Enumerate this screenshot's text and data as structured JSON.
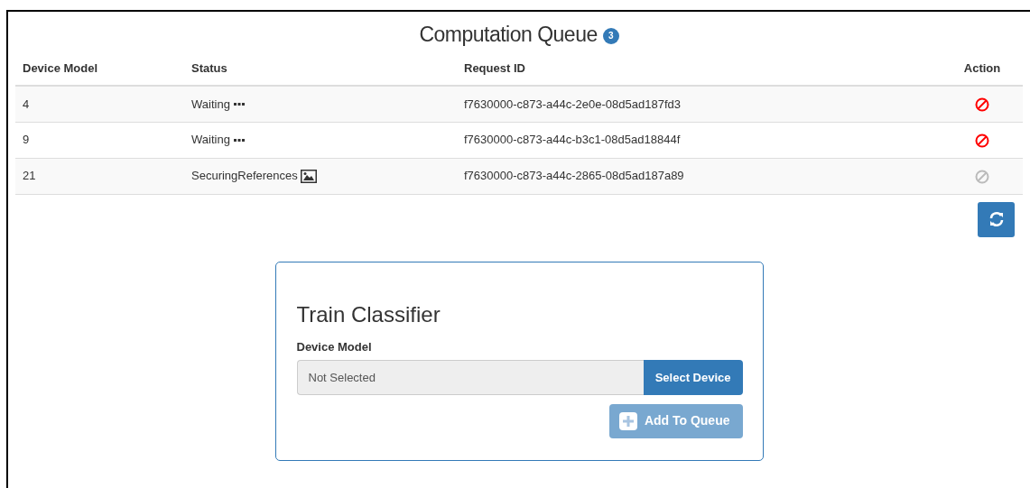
{
  "title": "Computation Queue",
  "count_badge": "3",
  "table": {
    "columns": [
      "Device Model",
      "Status",
      "Request ID",
      "Action"
    ],
    "rows": [
      {
        "device_model": "4",
        "status": "Waiting",
        "kind": "waiting",
        "request_id": "f7630000-c873-a44c-2e0e-08d5ad187fd3",
        "cancel_enabled": true
      },
      {
        "device_model": "9",
        "status": "Waiting",
        "kind": "waiting",
        "request_id": "f7630000-c873-a44c-b3c1-08d5ad18844f",
        "cancel_enabled": true
      },
      {
        "device_model": "21",
        "status": "SecuringReferences",
        "kind": "image",
        "request_id": "f7630000-c873-a44c-2865-08d5ad187a89",
        "cancel_enabled": false
      }
    ]
  },
  "train_classifier": {
    "title": "Train Classifier",
    "label": "Device Model",
    "placeholder": "Not Selected",
    "select_button": "Select Device",
    "add_button": "Add To Queue",
    "add_disabled": true
  }
}
